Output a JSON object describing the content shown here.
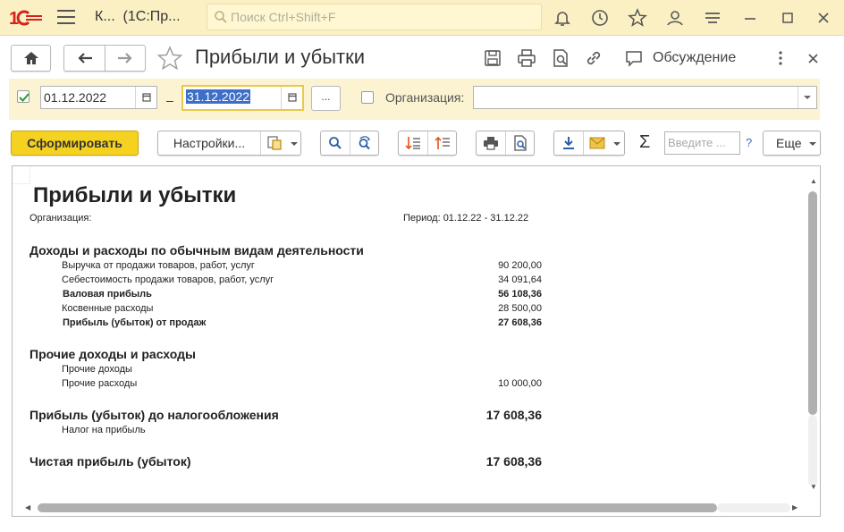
{
  "window": {
    "app_title": "К...  (1С:Пр...",
    "search_placeholder": "Поиск Ctrl+Shift+F",
    "accent": "#fbf0c4"
  },
  "form": {
    "title": "Прибыли и убытки",
    "discuss_label": "Обсуждение"
  },
  "period": {
    "enabled": true,
    "date_from": "01.12.2022",
    "dash": "–",
    "date_to": "31.12.2022",
    "more_label": "...",
    "org_label": "Организация:",
    "org_value": ""
  },
  "commands": {
    "generate_label": "Сформировать",
    "settings_label": "Настройки...",
    "sigma_label": "Σ",
    "find_placeholder": "Введите ...",
    "help_label": "?",
    "more_label": "Еще"
  },
  "report": {
    "title": "Прибыли и убытки",
    "org_label": "Организация:",
    "period_label": "Период: 01.12.22 - 31.12.22",
    "sections": [
      {
        "heading": "Доходы и расходы по обычным видам деятельности",
        "rows": [
          {
            "label": "Выручка от продажи товаров, работ, услуг",
            "value": "90 200,00",
            "bold": false
          },
          {
            "label": "Себестоимость продажи товаров, работ, услуг",
            "value": "34 091,64",
            "bold": false
          },
          {
            "label": "Валовая прибыль",
            "value": "56 108,36",
            "bold": true
          },
          {
            "label": "Косвенные расходы",
            "value": "28 500,00",
            "bold": false
          },
          {
            "label": "Прибыль (убыток) от продаж",
            "value": "27 608,36",
            "bold": true
          }
        ]
      },
      {
        "heading": "Прочие доходы и расходы",
        "rows": [
          {
            "label": "Прочие доходы",
            "value": "",
            "bold": false
          },
          {
            "label": "Прочие расходы",
            "value": "10 000,00",
            "bold": false
          }
        ]
      }
    ],
    "pretax": {
      "label": "Прибыль (убыток) до налогообложения",
      "value": "17 608,36"
    },
    "tax": {
      "label": "Налог на прибыль",
      "value": ""
    },
    "net": {
      "label": "Чистая прибыль (убыток)",
      "value": "17 608,36"
    }
  }
}
